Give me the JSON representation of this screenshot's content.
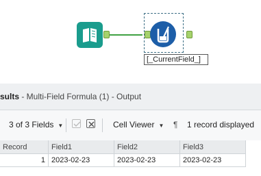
{
  "canvas": {
    "formula_label": "[_CurrentField_]"
  },
  "results": {
    "title_prefix": "sults",
    "title_rest": " - Multi-Field Formula (1) - Output"
  },
  "toolbar": {
    "fields_label": "3 of 3 Fields",
    "viewer_label": "Cell Viewer",
    "pilcrow": "¶",
    "record_status": "1 record displayed"
  },
  "table": {
    "headers": [
      "Record",
      "Field1",
      "Field2",
      "Field3"
    ],
    "row": [
      "1",
      "2023-02-23",
      "2023-02-23",
      "2023-02-23"
    ]
  }
}
